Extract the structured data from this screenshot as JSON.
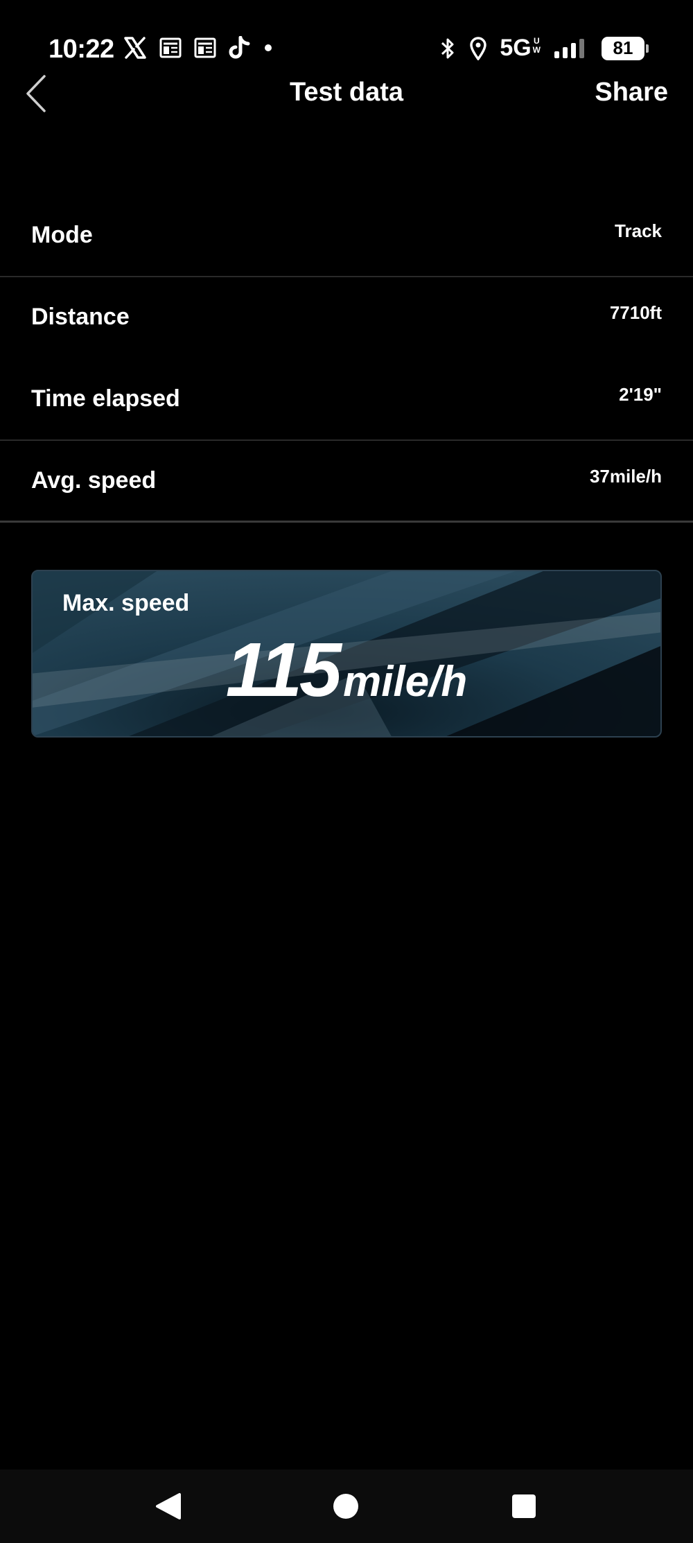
{
  "status_bar": {
    "time": "10:22",
    "left_icons": [
      "x-icon",
      "news-icon",
      "news-icon",
      "tiktok-icon",
      "dot-icon"
    ],
    "network": "5G",
    "network_sub_top": "U",
    "network_sub_bottom": "W",
    "battery": "81",
    "right_icons": [
      "bluetooth-icon",
      "location-icon",
      "signal-icon"
    ]
  },
  "header": {
    "title": "Test data",
    "share_label": "Share"
  },
  "rows": [
    {
      "label": "Mode",
      "value": "Track"
    },
    {
      "label": "Distance",
      "value": "7710ft"
    },
    {
      "label": "Time elapsed",
      "value": "2'19\""
    },
    {
      "label": "Avg. speed",
      "value": "37mile/h"
    }
  ],
  "max_speed": {
    "label": "Max. speed",
    "value": "115",
    "unit": "mile/h"
  },
  "nav_bar": {
    "icons": [
      "nav-back-icon",
      "nav-home-icon",
      "nav-recents-icon"
    ]
  }
}
